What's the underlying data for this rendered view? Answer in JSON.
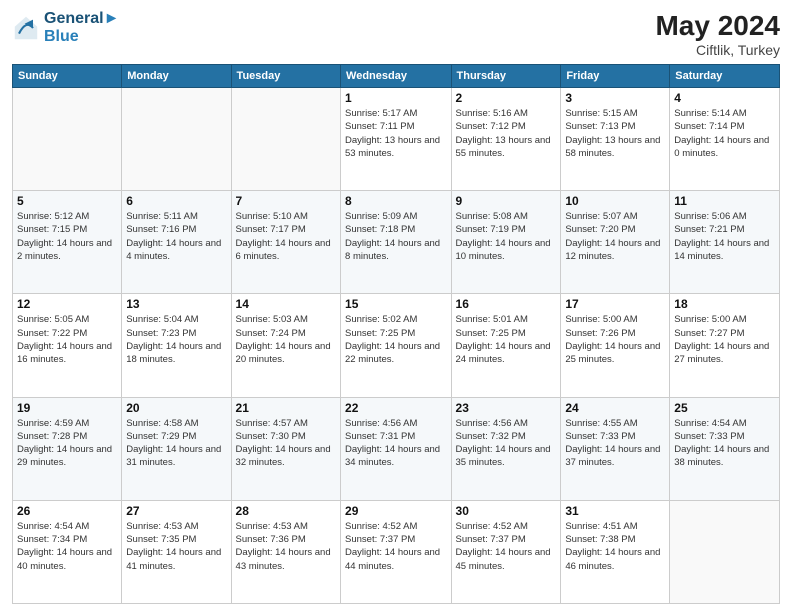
{
  "logo": {
    "line1": "General",
    "line2": "Blue"
  },
  "title": "May 2024",
  "location": "Ciftlik, Turkey",
  "headers": [
    "Sunday",
    "Monday",
    "Tuesday",
    "Wednesday",
    "Thursday",
    "Friday",
    "Saturday"
  ],
  "weeks": [
    [
      {
        "day": "",
        "sunrise": "",
        "sunset": "",
        "daylight": ""
      },
      {
        "day": "",
        "sunrise": "",
        "sunset": "",
        "daylight": ""
      },
      {
        "day": "",
        "sunrise": "",
        "sunset": "",
        "daylight": ""
      },
      {
        "day": "1",
        "sunrise": "Sunrise: 5:17 AM",
        "sunset": "Sunset: 7:11 PM",
        "daylight": "Daylight: 13 hours and 53 minutes."
      },
      {
        "day": "2",
        "sunrise": "Sunrise: 5:16 AM",
        "sunset": "Sunset: 7:12 PM",
        "daylight": "Daylight: 13 hours and 55 minutes."
      },
      {
        "day": "3",
        "sunrise": "Sunrise: 5:15 AM",
        "sunset": "Sunset: 7:13 PM",
        "daylight": "Daylight: 13 hours and 58 minutes."
      },
      {
        "day": "4",
        "sunrise": "Sunrise: 5:14 AM",
        "sunset": "Sunset: 7:14 PM",
        "daylight": "Daylight: 14 hours and 0 minutes."
      }
    ],
    [
      {
        "day": "5",
        "sunrise": "Sunrise: 5:12 AM",
        "sunset": "Sunset: 7:15 PM",
        "daylight": "Daylight: 14 hours and 2 minutes."
      },
      {
        "day": "6",
        "sunrise": "Sunrise: 5:11 AM",
        "sunset": "Sunset: 7:16 PM",
        "daylight": "Daylight: 14 hours and 4 minutes."
      },
      {
        "day": "7",
        "sunrise": "Sunrise: 5:10 AM",
        "sunset": "Sunset: 7:17 PM",
        "daylight": "Daylight: 14 hours and 6 minutes."
      },
      {
        "day": "8",
        "sunrise": "Sunrise: 5:09 AM",
        "sunset": "Sunset: 7:18 PM",
        "daylight": "Daylight: 14 hours and 8 minutes."
      },
      {
        "day": "9",
        "sunrise": "Sunrise: 5:08 AM",
        "sunset": "Sunset: 7:19 PM",
        "daylight": "Daylight: 14 hours and 10 minutes."
      },
      {
        "day": "10",
        "sunrise": "Sunrise: 5:07 AM",
        "sunset": "Sunset: 7:20 PM",
        "daylight": "Daylight: 14 hours and 12 minutes."
      },
      {
        "day": "11",
        "sunrise": "Sunrise: 5:06 AM",
        "sunset": "Sunset: 7:21 PM",
        "daylight": "Daylight: 14 hours and 14 minutes."
      }
    ],
    [
      {
        "day": "12",
        "sunrise": "Sunrise: 5:05 AM",
        "sunset": "Sunset: 7:22 PM",
        "daylight": "Daylight: 14 hours and 16 minutes."
      },
      {
        "day": "13",
        "sunrise": "Sunrise: 5:04 AM",
        "sunset": "Sunset: 7:23 PM",
        "daylight": "Daylight: 14 hours and 18 minutes."
      },
      {
        "day": "14",
        "sunrise": "Sunrise: 5:03 AM",
        "sunset": "Sunset: 7:24 PM",
        "daylight": "Daylight: 14 hours and 20 minutes."
      },
      {
        "day": "15",
        "sunrise": "Sunrise: 5:02 AM",
        "sunset": "Sunset: 7:25 PM",
        "daylight": "Daylight: 14 hours and 22 minutes."
      },
      {
        "day": "16",
        "sunrise": "Sunrise: 5:01 AM",
        "sunset": "Sunset: 7:25 PM",
        "daylight": "Daylight: 14 hours and 24 minutes."
      },
      {
        "day": "17",
        "sunrise": "Sunrise: 5:00 AM",
        "sunset": "Sunset: 7:26 PM",
        "daylight": "Daylight: 14 hours and 25 minutes."
      },
      {
        "day": "18",
        "sunrise": "Sunrise: 5:00 AM",
        "sunset": "Sunset: 7:27 PM",
        "daylight": "Daylight: 14 hours and 27 minutes."
      }
    ],
    [
      {
        "day": "19",
        "sunrise": "Sunrise: 4:59 AM",
        "sunset": "Sunset: 7:28 PM",
        "daylight": "Daylight: 14 hours and 29 minutes."
      },
      {
        "day": "20",
        "sunrise": "Sunrise: 4:58 AM",
        "sunset": "Sunset: 7:29 PM",
        "daylight": "Daylight: 14 hours and 31 minutes."
      },
      {
        "day": "21",
        "sunrise": "Sunrise: 4:57 AM",
        "sunset": "Sunset: 7:30 PM",
        "daylight": "Daylight: 14 hours and 32 minutes."
      },
      {
        "day": "22",
        "sunrise": "Sunrise: 4:56 AM",
        "sunset": "Sunset: 7:31 PM",
        "daylight": "Daylight: 14 hours and 34 minutes."
      },
      {
        "day": "23",
        "sunrise": "Sunrise: 4:56 AM",
        "sunset": "Sunset: 7:32 PM",
        "daylight": "Daylight: 14 hours and 35 minutes."
      },
      {
        "day": "24",
        "sunrise": "Sunrise: 4:55 AM",
        "sunset": "Sunset: 7:33 PM",
        "daylight": "Daylight: 14 hours and 37 minutes."
      },
      {
        "day": "25",
        "sunrise": "Sunrise: 4:54 AM",
        "sunset": "Sunset: 7:33 PM",
        "daylight": "Daylight: 14 hours and 38 minutes."
      }
    ],
    [
      {
        "day": "26",
        "sunrise": "Sunrise: 4:54 AM",
        "sunset": "Sunset: 7:34 PM",
        "daylight": "Daylight: 14 hours and 40 minutes."
      },
      {
        "day": "27",
        "sunrise": "Sunrise: 4:53 AM",
        "sunset": "Sunset: 7:35 PM",
        "daylight": "Daylight: 14 hours and 41 minutes."
      },
      {
        "day": "28",
        "sunrise": "Sunrise: 4:53 AM",
        "sunset": "Sunset: 7:36 PM",
        "daylight": "Daylight: 14 hours and 43 minutes."
      },
      {
        "day": "29",
        "sunrise": "Sunrise: 4:52 AM",
        "sunset": "Sunset: 7:37 PM",
        "daylight": "Daylight: 14 hours and 44 minutes."
      },
      {
        "day": "30",
        "sunrise": "Sunrise: 4:52 AM",
        "sunset": "Sunset: 7:37 PM",
        "daylight": "Daylight: 14 hours and 45 minutes."
      },
      {
        "day": "31",
        "sunrise": "Sunrise: 4:51 AM",
        "sunset": "Sunset: 7:38 PM",
        "daylight": "Daylight: 14 hours and 46 minutes."
      },
      {
        "day": "",
        "sunrise": "",
        "sunset": "",
        "daylight": ""
      }
    ]
  ]
}
